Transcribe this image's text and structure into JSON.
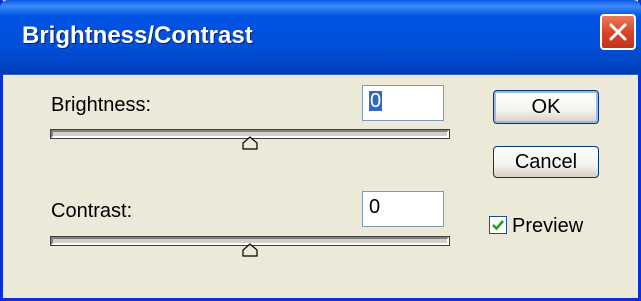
{
  "window": {
    "title": "Brightness/Contrast",
    "close_icon": "close-icon"
  },
  "brightness": {
    "label": "Brightness:",
    "value": "0",
    "slider_level": 0.5
  },
  "contrast": {
    "label": "Contrast:",
    "value": "0",
    "slider_level": 0.5
  },
  "buttons": {
    "ok_label": "OK",
    "cancel_label": "Cancel"
  },
  "preview": {
    "label": "Preview",
    "checked": true
  },
  "colors": {
    "titlebar": "#0054e3",
    "dialog_bg": "#ece9d8",
    "close_button": "#d8462a",
    "check_mark": "#21a121"
  }
}
